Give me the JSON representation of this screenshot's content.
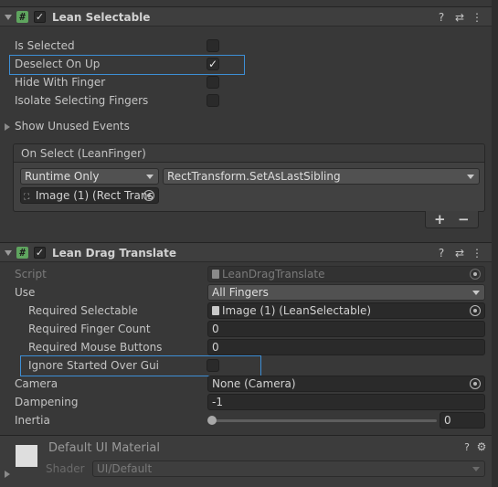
{
  "lean_selectable": {
    "title": "Lean Selectable",
    "enabled_mark": "✓",
    "fields": {
      "is_selected": "Is Selected",
      "deselect_on_up": "Deselect On Up",
      "hide_with_finger": "Hide With Finger",
      "isolate_selecting_fingers": "Isolate Selecting Fingers",
      "deselect_on_up_mark": "✓"
    },
    "show_unused_events": "Show Unused Events",
    "on_select": {
      "header": "On Select (LeanFinger)",
      "runtime": "Runtime Only",
      "function": "RectTransform.SetAsLastSibling",
      "object": "Image (1) (Rect Trans"
    },
    "add_label": "+",
    "remove_label": "−"
  },
  "lean_drag_translate": {
    "title": "Lean Drag Translate",
    "enabled_mark": "✓",
    "script_label": "Script",
    "script_value": "LeanDragTranslate",
    "use_label": "Use",
    "use_value": "All Fingers",
    "required_selectable_label": "Required Selectable",
    "required_selectable_value": "Image (1) (LeanSelectable)",
    "required_finger_count_label": "Required Finger Count",
    "required_finger_count_value": "0",
    "required_mouse_buttons_label": "Required Mouse Buttons",
    "required_mouse_buttons_value": "0",
    "ignore_started_over_gui_label": "Ignore Started Over Gui",
    "camera_label": "Camera",
    "camera_value": "None (Camera)",
    "dampening_label": "Dampening",
    "dampening_value": "-1",
    "inertia_label": "Inertia",
    "inertia_value": "0",
    "inertia_fraction": 0
  },
  "material": {
    "title": "Default UI Material",
    "shader_label": "Shader",
    "shader_value": "UI/Default"
  },
  "header_icons": {
    "help": "?",
    "presets": "⇄",
    "menu": "⋮"
  },
  "colors": {
    "highlight": "#3d8fd6",
    "script_icon": "#5fa55f"
  }
}
